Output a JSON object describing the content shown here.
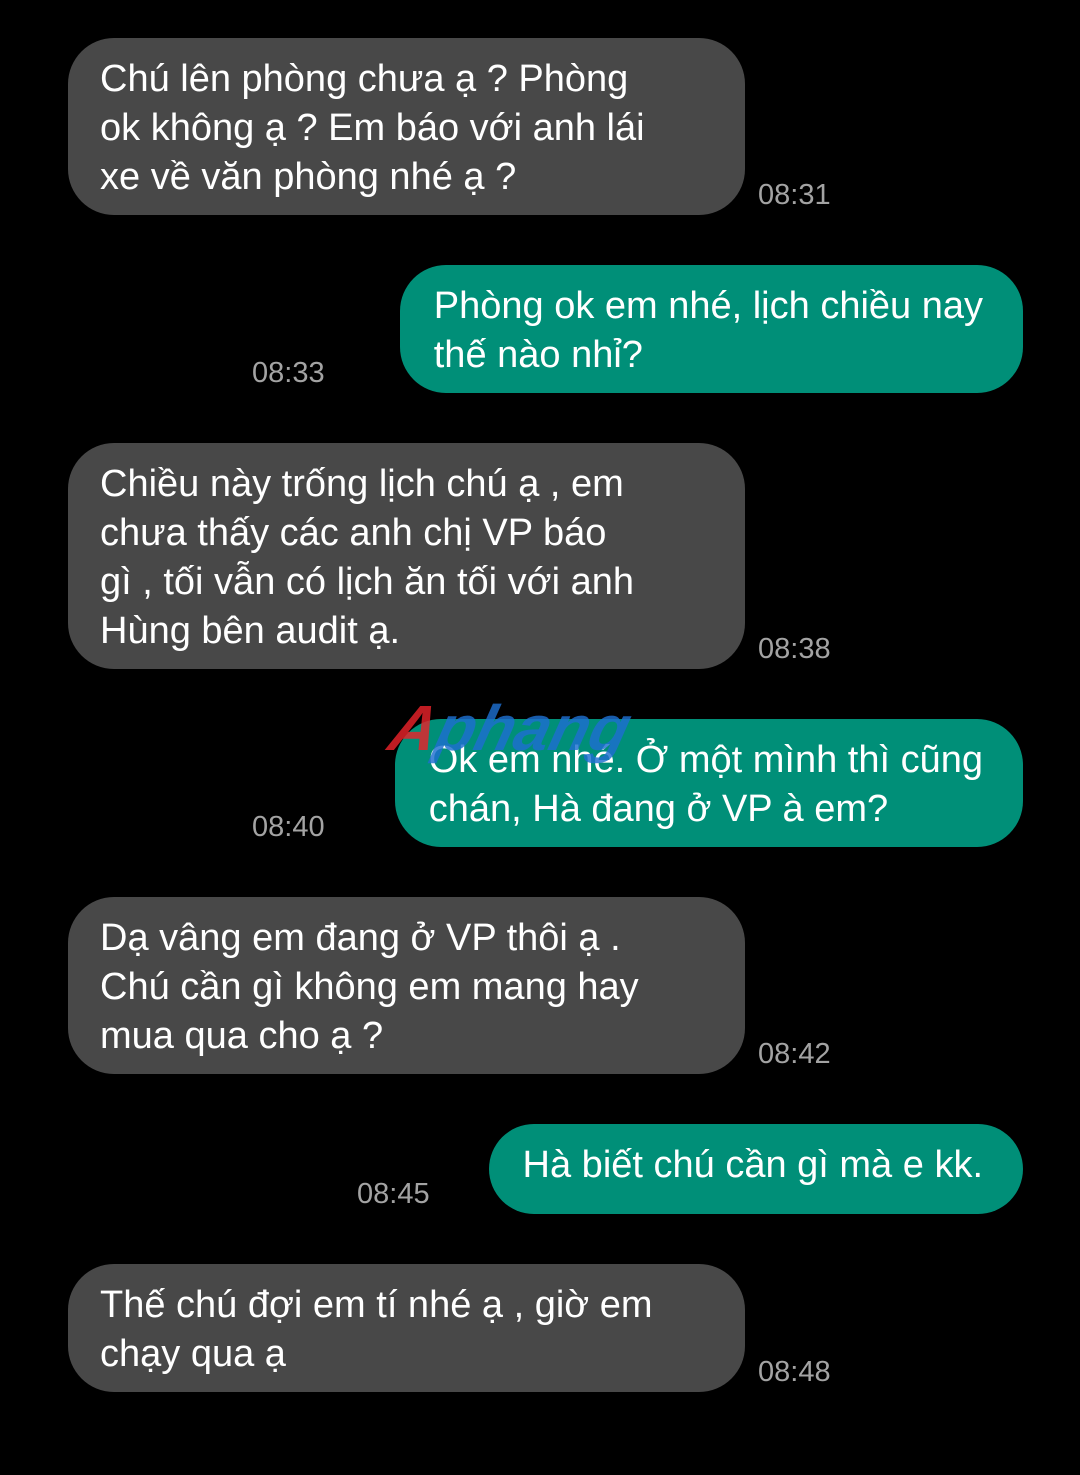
{
  "messages": [
    {
      "direction": "incoming",
      "text": " Chú lên phòng chưa ạ ? Phòng\nok không ạ ? Em báo với anh lái\nxe về văn phòng nhé ạ ?",
      "time": "08:31"
    },
    {
      "direction": "outgoing",
      "text": "Phòng ok em nhé, lịch chiều nay\nthế nào nhỉ?",
      "time": "08:33"
    },
    {
      "direction": "incoming",
      "text": "Chiều này trống lịch chú ạ , em\nchưa thấy các anh chị VP báo\ngì , tối vẫn có lịch ăn tối với anh\nHùng bên audit ạ.",
      "time": "08:38"
    },
    {
      "direction": "outgoing",
      "text": "Ok em nhé. Ở một mình thì cũng\nchán, Hà đang ở VP à em?",
      "time": "08:40"
    },
    {
      "direction": "incoming",
      "text": "Dạ vâng em đang ở VP thôi ạ .\nChú cần gì không em mang hay\nmua qua cho ạ ?",
      "time": "08:42"
    },
    {
      "direction": "outgoing",
      "text": "Hà biết chú cần gì mà e kk.",
      "time": "08:45"
    },
    {
      "direction": "incoming",
      "text": "Thế chú đợi em tí nhé ạ , giờ em\nchạy qua ạ",
      "time": "08:48"
    }
  ],
  "watermark": {
    "text": "Aphang",
    "colors": {
      "first_letter": "#e8232a",
      "rest": "#1e6fd0"
    }
  },
  "colors": {
    "background": "#000000",
    "incoming_bubble": "#484848",
    "outgoing_bubble": "#008f78",
    "timestamp": "#a3a3a3",
    "message_text": "#ffffff"
  }
}
